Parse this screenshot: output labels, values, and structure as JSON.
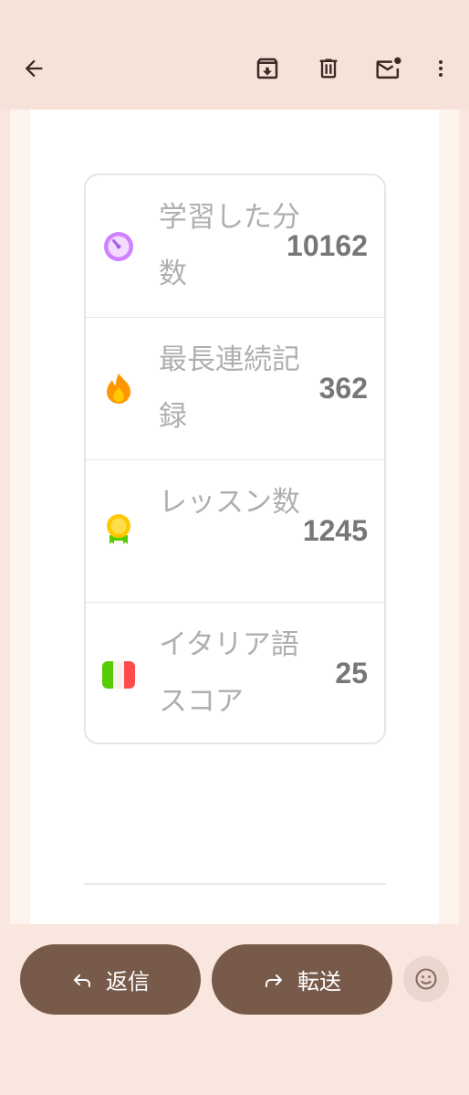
{
  "toolbar": {
    "back_icon": "arrow-back-icon",
    "archive_icon": "archive-icon",
    "delete_icon": "trash-icon",
    "unread_icon": "mark-unread-icon",
    "more_icon": "more-vert-icon"
  },
  "stats": {
    "rows": [
      {
        "label": "学習した分数",
        "value": "10162",
        "icon": "clock-icon",
        "color": "#ce82ff"
      },
      {
        "label": "最長連続記録",
        "value": "362",
        "icon": "fire-icon",
        "color": "#ff9600"
      },
      {
        "label": "レッスン数",
        "value": "1245",
        "icon": "medal-icon",
        "color": "#ffc800"
      },
      {
        "label": "イタリア語スコア",
        "value": "25",
        "icon": "italy-flag-icon",
        "color": "#58cc02"
      }
    ]
  },
  "actions": {
    "reply_label": "返信",
    "forward_label": "転送"
  },
  "colors": {
    "accent": "#775a49",
    "background": "#f9e6de",
    "label_text": "#afafaf",
    "value_text": "#777777"
  }
}
